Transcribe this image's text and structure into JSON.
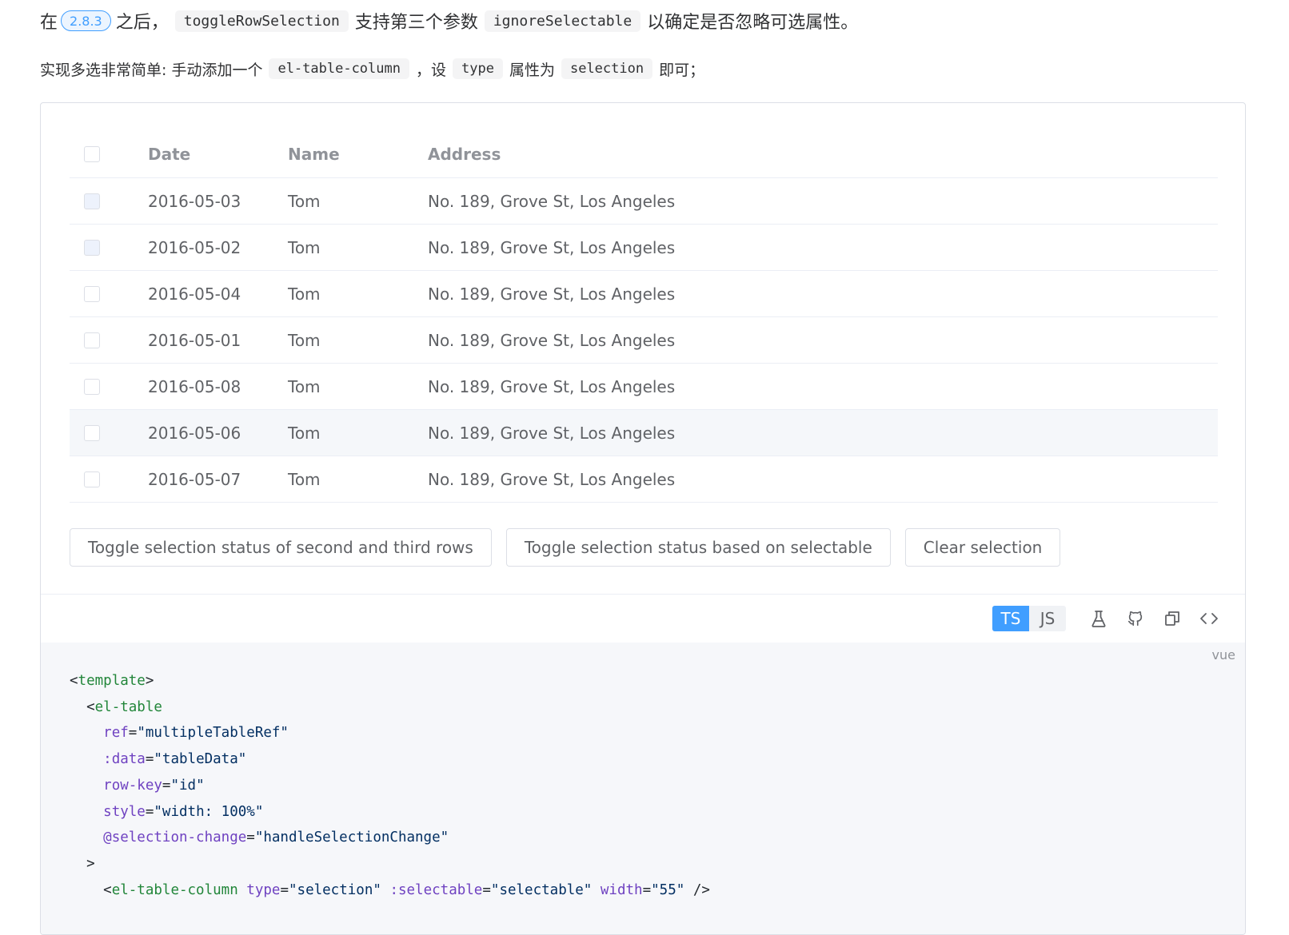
{
  "intro": {
    "p1_prefix": "在",
    "version": "2.8.3",
    "p1_after_version": "之后，",
    "code_toggle": "toggleRowSelection",
    "p1_mid": "支持第三个参数",
    "code_ignore": "ignoreSelectable",
    "p1_suffix": "以确定是否忽略可选属性。",
    "p2_prefix": "实现多选非常简单: 手动添加一个",
    "code_column": "el-table-column",
    "p2_mid1": "，设",
    "code_type": "type",
    "p2_mid2": "属性为",
    "code_selection": "selection",
    "p2_suffix": "即可；"
  },
  "table": {
    "columns": [
      "Date",
      "Name",
      "Address"
    ],
    "rows": [
      {
        "date": "2016-05-03",
        "name": "Tom",
        "address": "No. 189, Grove St, Los Angeles"
      },
      {
        "date": "2016-05-02",
        "name": "Tom",
        "address": "No. 189, Grove St, Los Angeles"
      },
      {
        "date": "2016-05-04",
        "name": "Tom",
        "address": "No. 189, Grove St, Los Angeles"
      },
      {
        "date": "2016-05-01",
        "name": "Tom",
        "address": "No. 189, Grove St, Los Angeles"
      },
      {
        "date": "2016-05-08",
        "name": "Tom",
        "address": "No. 189, Grove St, Los Angeles"
      },
      {
        "date": "2016-05-06",
        "name": "Tom",
        "address": "No. 189, Grove St, Los Angeles"
      },
      {
        "date": "2016-05-07",
        "name": "Tom",
        "address": "No. 189, Grove St, Los Angeles"
      }
    ]
  },
  "buttons": {
    "toggle_second_third": "Toggle selection status of second and third rows",
    "toggle_selectable": "Toggle selection status based on selectable",
    "clear": "Clear selection"
  },
  "toolbar": {
    "ts": "TS",
    "js": "JS",
    "icons": [
      "playground-icon",
      "github-icon",
      "copy-icon",
      "view-source-icon"
    ]
  },
  "code": {
    "lang": "vue",
    "l1_tag": "template",
    "l2_tag": "el-table",
    "ref_attr": "ref",
    "ref_val": "\"multipleTableRef\"",
    "data_attr": ":data",
    "data_val": "\"tableData\"",
    "rowkey_attr": "row-key",
    "rowkey_val": "\"id\"",
    "style_attr": "style",
    "style_val": "\"width: 100%\"",
    "sel_attr": "@selection-change",
    "sel_val": "\"handleSelectionChange\"",
    "close": ">",
    "col_tag": "el-table-column",
    "type_attr": "type",
    "type_val": "\"selection\"",
    "selectable_attr": ":selectable",
    "selectable_val": "\"selectable\"",
    "width_attr": "width",
    "width_val": "\"55\"",
    "self_close": " />"
  },
  "colors": {
    "primary": "#409eff",
    "border": "#dcdfe6",
    "code_bg": "#f6f7fa"
  }
}
